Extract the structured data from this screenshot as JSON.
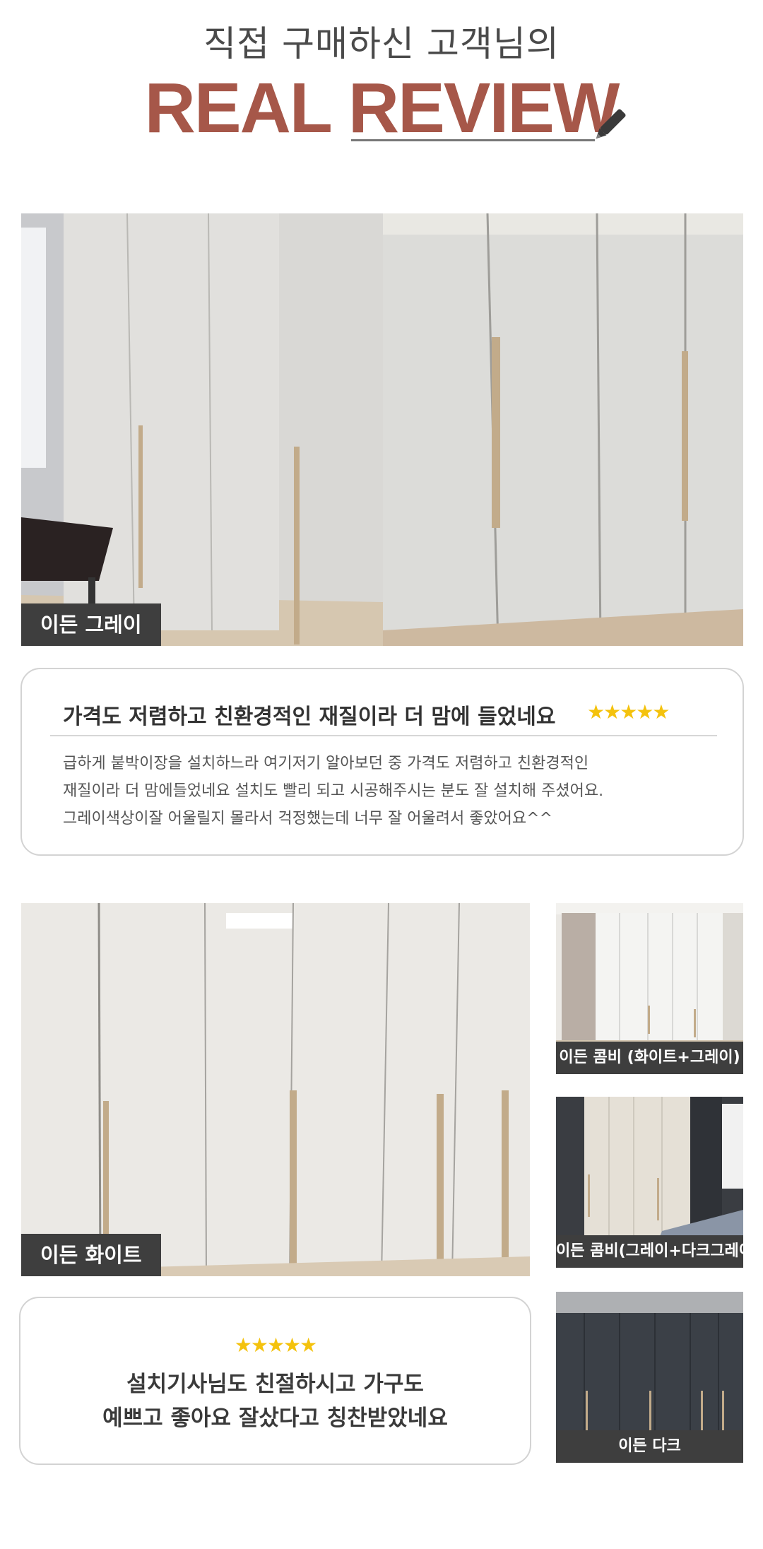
{
  "header": {
    "subtitle": "직접 구매하신 고객님의",
    "title": "REAL REVIEW"
  },
  "photos": [
    {
      "caption": "이든 그레이"
    },
    {
      "caption": "이든 화이트"
    },
    {
      "caption": "이든 콤비 (화이트+그레이)"
    },
    {
      "caption": "이든 콤비(그레이+다크그레이)"
    },
    {
      "caption": "이든 다크"
    }
  ],
  "review1": {
    "title": "가격도 저렴하고 친환경적인 재질이라 더 맘에 들었네요",
    "stars": "★★★★★",
    "body": [
      "급하게 붙박이장을 설치하느라 여기저기 알아보던 중 가격도 저렴하고 친환경적인",
      "재질이라 더 맘에들었네요 설치도 빨리 되고 시공해주시는 분도 잘 설치해 주셨어요.",
      "그레이색상이잘 어울릴지 몰라서 걱정했는데 너무 잘 어울려서 좋았어요^^"
    ]
  },
  "review2": {
    "stars": "★★★★★",
    "lines": [
      "설치기사님도 친절하시고 가구도",
      "예쁘고 좋아요 잘샀다고 칭찬받았네요"
    ]
  },
  "colors": {
    "accent": "#a65749",
    "star": "#f4c20d",
    "caption_bg": "#3e3e3e"
  },
  "icons": {
    "pencil": "pencil-icon"
  }
}
